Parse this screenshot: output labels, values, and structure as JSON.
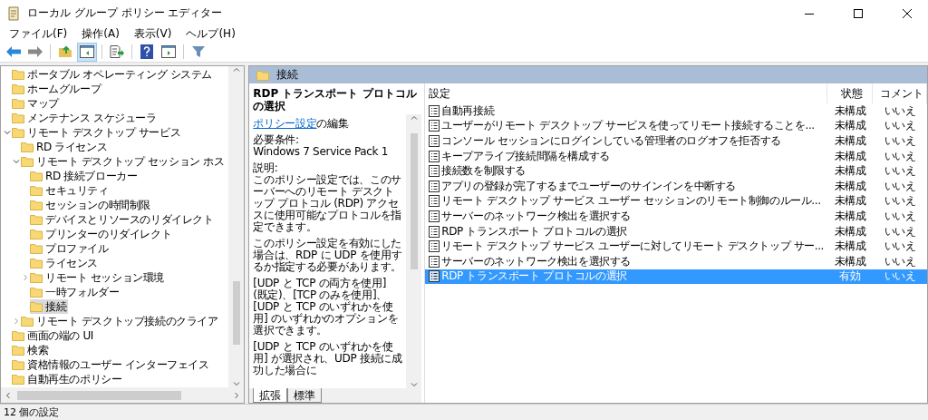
{
  "window": {
    "title": "ローカル グループ ポリシー エディター"
  },
  "menu": [
    "ファイル(F)",
    "操作(A)",
    "表示(V)",
    "ヘルプ(H)"
  ],
  "toolbar": [
    {
      "kind": "back",
      "disabled": false
    },
    {
      "kind": "forward",
      "disabled": true
    },
    {
      "kind": "sep"
    },
    {
      "kind": "up",
      "selected": false
    },
    {
      "kind": "tree",
      "selected": true
    },
    {
      "kind": "sep"
    },
    {
      "kind": "export",
      "selected": false
    },
    {
      "kind": "sep"
    },
    {
      "kind": "help",
      "selected": false
    },
    {
      "kind": "pane",
      "selected": false
    },
    {
      "kind": "sep"
    },
    {
      "kind": "filter",
      "selected": false
    }
  ],
  "tree": [
    {
      "label": "ポータブル オペレーティング システム",
      "selected": false
    },
    {
      "label": "ホームグループ",
      "selected": false
    },
    {
      "label": "マップ",
      "selected": false
    },
    {
      "label": "メンテナンス スケジューラ",
      "selected": false
    },
    {
      "label": "リモート デスクトップ サービス",
      "selected": false,
      "expanded": true,
      "children": [
        {
          "label": "RD ライセンス",
          "selected": false
        },
        {
          "label": "リモート デスクトップ セッション ホス",
          "selected": false,
          "expanded": true,
          "children": [
            {
              "label": "RD 接続ブローカー",
              "selected": false
            },
            {
              "label": "セキュリティ",
              "selected": false
            },
            {
              "label": "セッションの時間制限",
              "selected": false
            },
            {
              "label": "デバイスとリソースのリダイレクト",
              "selected": false
            },
            {
              "label": "プリンターのリダイレクト",
              "selected": false
            },
            {
              "label": "プロファイル",
              "selected": false
            },
            {
              "label": "ライセンス",
              "selected": false
            },
            {
              "label": "リモート セッション環境",
              "selected": false,
              "expanded": false
            },
            {
              "label": "一時フォルダー",
              "selected": false
            },
            {
              "label": "接続",
              "selected": true
            }
          ]
        },
        {
          "label": "リモート デスクトップ接続のクライア",
          "selected": false,
          "expanded": false
        }
      ]
    },
    {
      "label": "画面の端の UI",
      "selected": false
    },
    {
      "label": "検索",
      "selected": false
    },
    {
      "label": "資格情報のユーザー インターフェイス",
      "selected": false
    },
    {
      "label": "自動再生のポリシー",
      "selected": false
    }
  ],
  "header": {
    "title": "接続"
  },
  "description": {
    "title": "RDP トランスポート プロトコルの選択",
    "link": "ポリシー設定",
    "link_suffix": "の編集",
    "requirement_label": "必要条件:",
    "requirement": "Windows 7 Service Pack 1",
    "explanation_label": "説明:",
    "paragraphs": [
      "このポリシー設定では、このサーバーへのリモート デスクトップ プロトコル (RDP) アクセスに使用可能なプロトコルを指定できます。",
      "このポリシー設定を有効にした場合は、RDP に UDP を使用するか指定する必要があります。",
      "[UDP と TCP の両方を使用] (既定)、[TCP のみを使用]、[UDP と TCP のいずれかを使用] のいずれかのオプションを選択できます。",
      "[UDP と TCP のいずれかを使用] が選択され、UDP 接続に成功した場合に"
    ]
  },
  "tabs": [
    {
      "label": "拡張",
      "selected": true
    },
    {
      "label": "標準",
      "selected": false
    }
  ],
  "table": {
    "columns": [
      "設定",
      "状態",
      "コメント"
    ],
    "rows": [
      {
        "setting": "自動再接続",
        "state": "未構成",
        "comment": "いいえ",
        "selected": false
      },
      {
        "setting": "ユーザーがリモート デスクトップ サービスを使ってリモート接続することを...",
        "state": "未構成",
        "comment": "いいえ",
        "selected": false
      },
      {
        "setting": "コンソール セッションにログインしている管理者のログオフを拒否する",
        "state": "未構成",
        "comment": "いいえ",
        "selected": false
      },
      {
        "setting": "キープアライブ接続間隔を構成する",
        "state": "未構成",
        "comment": "いいえ",
        "selected": false
      },
      {
        "setting": "接続数を制限する",
        "state": "未構成",
        "comment": "いいえ",
        "selected": false
      },
      {
        "setting": "アプリの登録が完了するまでユーザーのサインインを中断する",
        "state": "未構成",
        "comment": "いいえ",
        "selected": false
      },
      {
        "setting": "リモート デスクトップ サービス ユーザー セッションのリモート制御のルール...",
        "state": "未構成",
        "comment": "いいえ",
        "selected": false
      },
      {
        "setting": "サーバーのネットワーク検出を選択する",
        "state": "未構成",
        "comment": "いいえ",
        "selected": false
      },
      {
        "setting": "RDP トランスポート プロトコルの選択",
        "state": "未構成",
        "comment": "いいえ",
        "selected": false
      },
      {
        "setting": "リモート デスクトップ サービス ユーザーに対してリモート デスクトップ サー...",
        "state": "未構成",
        "comment": "いいえ",
        "selected": false
      },
      {
        "setting": "サーバーのネットワーク検出を選択する",
        "state": "未構成",
        "comment": "いいえ",
        "selected": false
      },
      {
        "setting": "RDP トランスポート プロトコルの選択",
        "state": "有効",
        "comment": "いいえ",
        "selected": true
      }
    ]
  },
  "status_bar": "12 個の設定"
}
